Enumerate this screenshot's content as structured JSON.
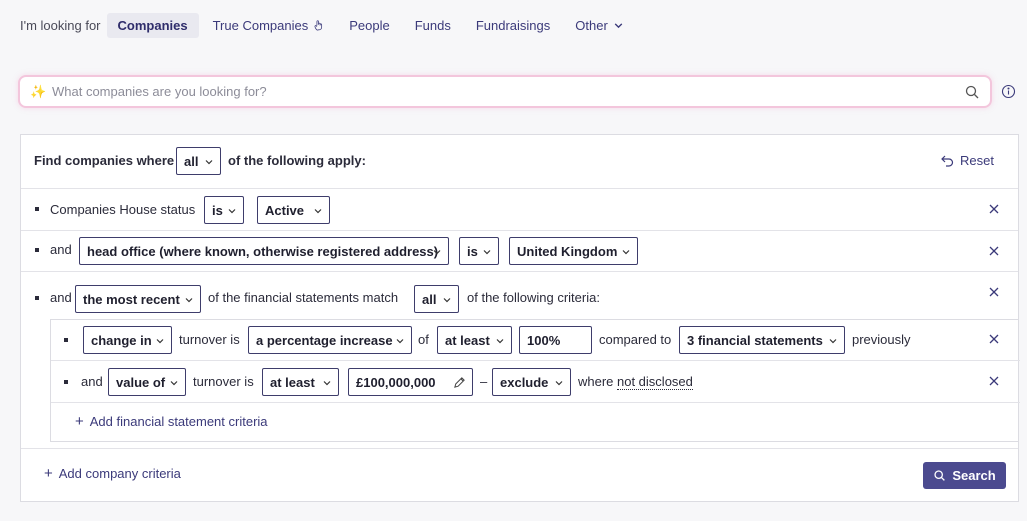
{
  "tabs": {
    "lead": "I'm looking for",
    "items": [
      {
        "label": "Companies",
        "active": true
      },
      {
        "label": "True Companies"
      },
      {
        "label": "People"
      },
      {
        "label": "Funds"
      },
      {
        "label": "Fundraisings"
      },
      {
        "label": "Other"
      }
    ]
  },
  "search": {
    "placeholder": "What companies are you looking for?"
  },
  "builder": {
    "header_prefix": "Find companies where",
    "header_match": "all",
    "header_suffix": "of the following apply:",
    "reset_label": "Reset",
    "rule1": {
      "field": "Companies House status",
      "op": "is",
      "value": "Active"
    },
    "rule2": {
      "conj": "and",
      "field": "head office (where known, otherwise registered address)",
      "op": "is",
      "value": "United Kingdom"
    },
    "rule3": {
      "conj": "and",
      "scope": "the most recent",
      "text1": "of the financial statements match",
      "match": "all",
      "text2": "of the following criteria:",
      "sub1": {
        "mode": "change in",
        "metric": "turnover is",
        "change": "a percentage increase",
        "of": "of",
        "cmp": "at least",
        "amount": "100%",
        "compared": "compared to",
        "period": "3 financial statements",
        "tail": "previously"
      },
      "sub2": {
        "conj": "and",
        "mode": "value of",
        "metric": "turnover is",
        "cmp": "at least",
        "amount": "£100,000,000",
        "dash": "–",
        "exclude": "exclude",
        "where": "where",
        "nd": "not disclosed"
      },
      "add_fin_label": "Add financial statement criteria"
    },
    "add_company_label": "Add company criteria",
    "search_label": "Search"
  },
  "colors": {
    "accent": "#4b4a8f",
    "tab_active_bg": "#e9e9f0",
    "search_glow": "#f3c6dc"
  }
}
